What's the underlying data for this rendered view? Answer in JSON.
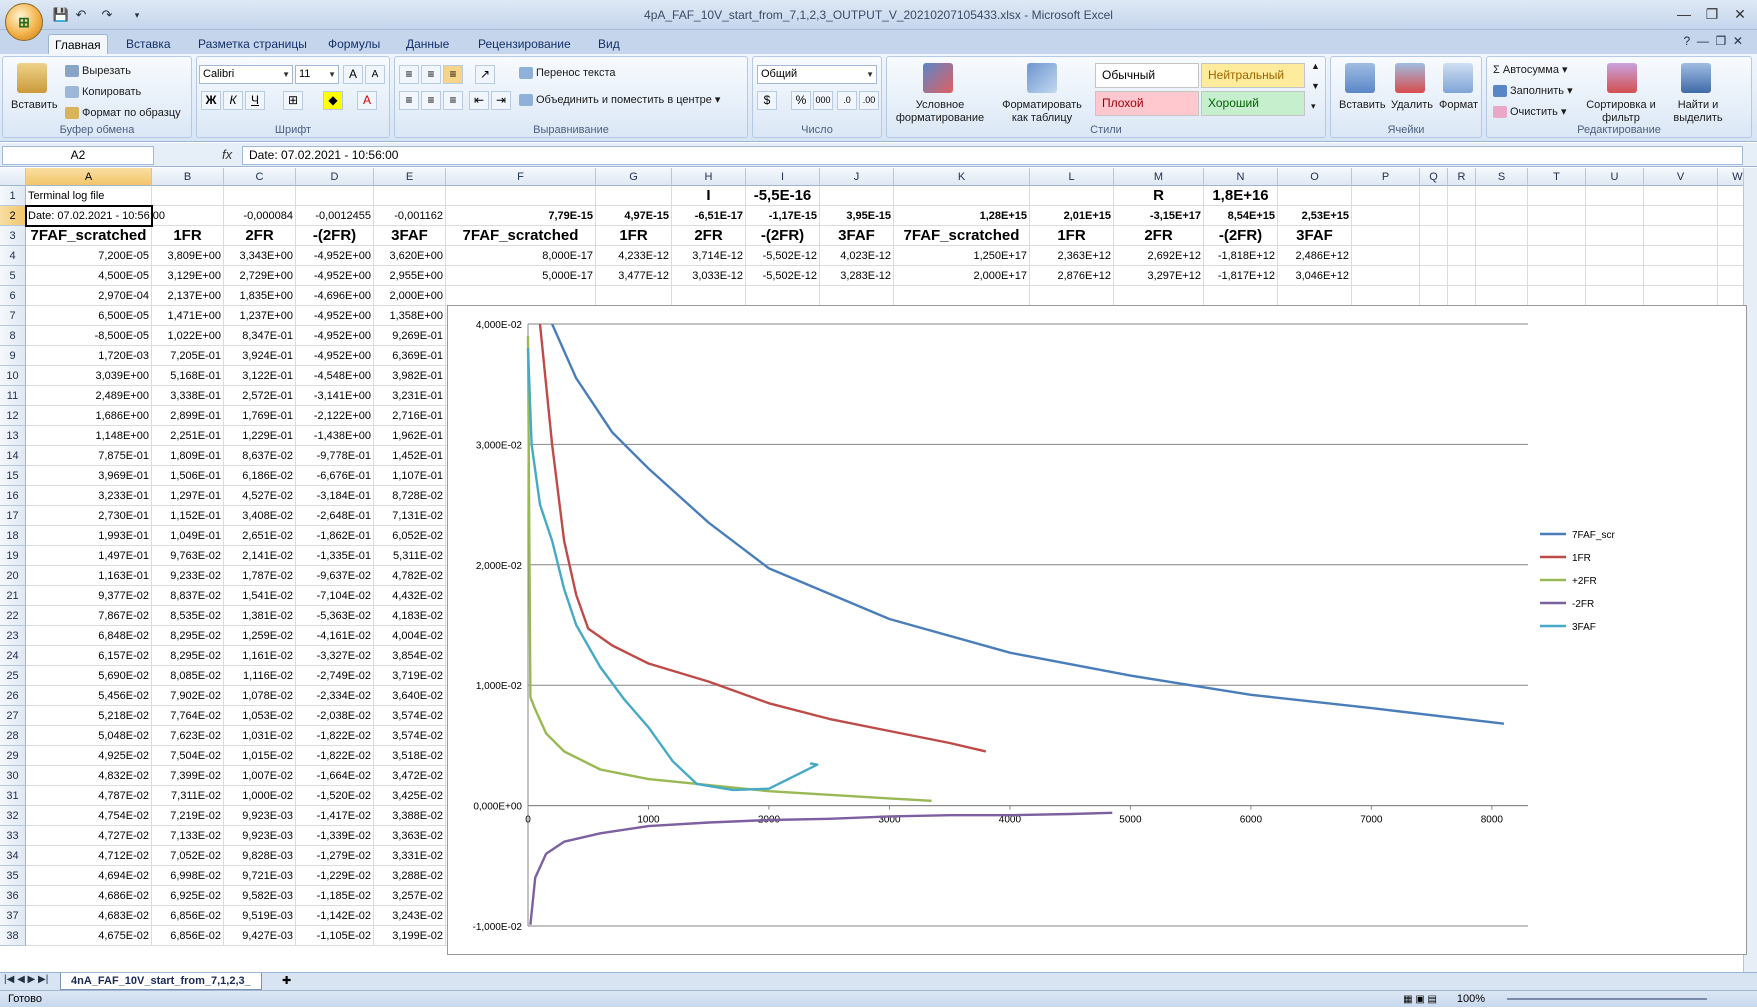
{
  "window": {
    "title": "4pA_FAF_10V_start_from_7,1,2,3_OUTPUT_V_20210207105433.xlsx - Microsoft Excel"
  },
  "tabs": [
    "Главная",
    "Вставка",
    "Разметка страницы",
    "Формулы",
    "Данные",
    "Рецензирование",
    "Вид"
  ],
  "ribbon": {
    "clipboard": {
      "label": "Буфер обмена",
      "paste": "Вставить",
      "cut": "Вырезать",
      "copy": "Копировать",
      "format_painter": "Формат по образцу"
    },
    "font": {
      "label": "Шрифт",
      "name": "Calibri",
      "size": "11"
    },
    "alignment": {
      "label": "Выравнивание",
      "wrap": "Перенос текста",
      "merge": "Объединить и поместить в центре"
    },
    "number": {
      "label": "Число",
      "format": "Общий"
    },
    "styles": {
      "label": "Стили",
      "cond": "Условное форматирование",
      "as_table": "Форматировать как таблицу",
      "normal": "Обычный",
      "neutral": "Нейтральный",
      "bad": "Плохой",
      "good": "Хороший"
    },
    "cells": {
      "label": "Ячейки",
      "insert": "Вставить",
      "delete": "Удалить",
      "format": "Формат"
    },
    "editing": {
      "label": "Редактирование",
      "autosum": "Автосумма",
      "fill": "Заполнить",
      "clear": "Очистить",
      "sort": "Сортировка и фильтр",
      "find": "Найти и выделить"
    }
  },
  "formula_bar": {
    "name_box": "A2",
    "fx": "fx",
    "content": "Date: 07.02.2021 - 10:56:00"
  },
  "columns": [
    "A",
    "B",
    "C",
    "D",
    "E",
    "F",
    "G",
    "H",
    "I",
    "J",
    "K",
    "L",
    "M",
    "N",
    "O",
    "P",
    "Q",
    "R",
    "S",
    "T",
    "U",
    "V",
    "W"
  ],
  "row_numbers": [
    "1",
    "2",
    "3",
    "4",
    "5",
    "6",
    "7",
    "8",
    "9",
    "10",
    "11",
    "12",
    "13",
    "14",
    "15",
    "16",
    "17",
    "18",
    "19",
    "20",
    "21",
    "22",
    "23",
    "24",
    "25",
    "26",
    "27",
    "28",
    "29",
    "30",
    "31",
    "32",
    "33",
    "34",
    "35",
    "36",
    "37",
    "38"
  ],
  "row1": {
    "A": "Terminal log file",
    "H": "I",
    "I": "-5,5E-16",
    "M": "R",
    "N": "1,8E+16"
  },
  "row2": {
    "A": "Date: 07.02.2021 - 10:56:00",
    "C": "-0,000084",
    "D": "-0,0012455",
    "E": "-0,001162",
    "F": "7,79E-15",
    "G": "4,97E-15",
    "H": "-6,51E-17",
    "I": "-1,17E-15",
    "J": "3,95E-15",
    "K": "1,28E+15",
    "L": "2,01E+15",
    "M": "-3,15E+17",
    "N": "8,54E+15",
    "O": "2,53E+15"
  },
  "row3": {
    "A": "7FAF_scratched",
    "B": "1FR",
    "C": "2FR",
    "D": "-(2FR)",
    "E": "3FAF",
    "F": "7FAF_scratched",
    "G": "1FR",
    "H": "2FR",
    "I": "-(2FR)",
    "J": "3FAF",
    "K": "7FAF_scratched",
    "L": "1FR",
    "M": "2FR",
    "N": "-(2FR)",
    "O": "3FAF"
  },
  "row4": {
    "F": "8,000E-17",
    "G": "4,233E-12",
    "H": "3,714E-12",
    "I": "-5,502E-12",
    "J": "4,023E-12",
    "K": "1,250E+17",
    "L": "2,363E+12",
    "M": "2,692E+12",
    "N": "-1,818E+12",
    "O": "2,486E+12"
  },
  "row5": {
    "F": "5,000E-17",
    "G": "3,477E-12",
    "H": "3,033E-12",
    "I": "-5,502E-12",
    "J": "3,283E-12",
    "K": "2,000E+17",
    "L": "2,876E+12",
    "M": "3,297E+12",
    "N": "-1,817E+12",
    "O": "3,046E+12"
  },
  "table_rows": [
    [
      "7,200E-05",
      "3,809E+00",
      "3,343E+00",
      "-4,952E+00",
      "3,620E+00"
    ],
    [
      "4,500E-05",
      "3,129E+00",
      "2,729E+00",
      "-4,952E+00",
      "2,955E+00"
    ],
    [
      "2,970E-04",
      "2,137E+00",
      "1,835E+00",
      "-4,696E+00",
      "2,000E+00"
    ],
    [
      "6,500E-05",
      "1,471E+00",
      "1,237E+00",
      "-4,952E+00",
      "1,358E+00"
    ],
    [
      "-8,500E-05",
      "1,022E+00",
      "8,347E-01",
      "-4,952E+00",
      "9,269E-01"
    ],
    [
      "1,720E-03",
      "7,205E-01",
      "3,924E-01",
      "-4,952E+00",
      "6,369E-01"
    ],
    [
      "3,039E+00",
      "5,168E-01",
      "3,122E-01",
      "-4,548E+00",
      "3,982E-01"
    ],
    [
      "2,489E+00",
      "3,338E-01",
      "2,572E-01",
      "-3,141E+00",
      "3,231E-01"
    ],
    [
      "1,686E+00",
      "2,899E-01",
      "1,769E-01",
      "-2,122E+00",
      "2,716E-01"
    ],
    [
      "1,148E+00",
      "2,251E-01",
      "1,229E-01",
      "-1,438E+00",
      "1,962E-01"
    ],
    [
      "7,875E-01",
      "1,809E-01",
      "8,637E-02",
      "-9,778E-01",
      "1,452E-01"
    ],
    [
      "3,969E-01",
      "1,506E-01",
      "6,186E-02",
      "-6,676E-01",
      "1,107E-01"
    ],
    [
      "3,233E-01",
      "1,297E-01",
      "4,527E-02",
      "-3,184E-01",
      "8,728E-02"
    ],
    [
      "2,730E-01",
      "1,152E-01",
      "3,408E-02",
      "-2,648E-01",
      "7,131E-02"
    ],
    [
      "1,993E-01",
      "1,049E-01",
      "2,651E-02",
      "-1,862E-01",
      "6,052E-02"
    ],
    [
      "1,497E-01",
      "9,763E-02",
      "2,141E-02",
      "-1,335E-01",
      "5,311E-02"
    ],
    [
      "1,163E-01",
      "9,233E-02",
      "1,787E-02",
      "-9,637E-02",
      "4,782E-02"
    ],
    [
      "9,377E-02",
      "8,837E-02",
      "1,541E-02",
      "-7,104E-02",
      "4,432E-02"
    ],
    [
      "7,867E-02",
      "8,535E-02",
      "1,381E-02",
      "-5,363E-02",
      "4,183E-02"
    ],
    [
      "6,848E-02",
      "8,295E-02",
      "1,259E-02",
      "-4,161E-02",
      "4,004E-02"
    ],
    [
      "6,157E-02",
      "8,295E-02",
      "1,161E-02",
      "-3,327E-02",
      "3,854E-02"
    ],
    [
      "5,690E-02",
      "8,085E-02",
      "1,116E-02",
      "-2,749E-02",
      "3,719E-02"
    ],
    [
      "5,456E-02",
      "7,902E-02",
      "1,078E-02",
      "-2,334E-02",
      "3,640E-02"
    ],
    [
      "5,218E-02",
      "7,764E-02",
      "1,053E-02",
      "-2,038E-02",
      "3,574E-02"
    ],
    [
      "5,048E-02",
      "7,623E-02",
      "1,031E-02",
      "-1,822E-02",
      "3,574E-02"
    ],
    [
      "4,925E-02",
      "7,504E-02",
      "1,015E-02",
      "-1,822E-02",
      "3,518E-02"
    ],
    [
      "4,832E-02",
      "7,399E-02",
      "1,007E-02",
      "-1,664E-02",
      "3,472E-02"
    ],
    [
      "4,787E-02",
      "7,311E-02",
      "1,000E-02",
      "-1,520E-02",
      "3,425E-02"
    ],
    [
      "4,754E-02",
      "7,219E-02",
      "9,923E-03",
      "-1,417E-02",
      "3,388E-02"
    ],
    [
      "4,727E-02",
      "7,133E-02",
      "9,923E-03",
      "-1,339E-02",
      "3,363E-02"
    ],
    [
      "4,712E-02",
      "7,052E-02",
      "9,828E-03",
      "-1,279E-02",
      "3,331E-02"
    ],
    [
      "4,694E-02",
      "6,998E-02",
      "9,721E-03",
      "-1,229E-02",
      "3,288E-02"
    ],
    [
      "4,686E-02",
      "6,925E-02",
      "9,582E-03",
      "-1,185E-02",
      "3,257E-02"
    ],
    [
      "4,683E-02",
      "6,856E-02",
      "9,519E-03",
      "-1,142E-02",
      "3,243E-02"
    ],
    [
      "4,675E-02",
      "6,856E-02",
      "9,427E-03",
      "-1,105E-02",
      "3,199E-02"
    ]
  ],
  "chart_data": {
    "type": "line",
    "yticks": [
      "4,000E-02",
      "3,000E-02",
      "2,000E-02",
      "1,000E-02",
      "0,000E+00",
      "-1,000E-02"
    ],
    "xticks": [
      "0",
      "1000",
      "2000",
      "3000",
      "4000",
      "5000",
      "6000",
      "7000",
      "8000"
    ],
    "ylim": [
      -0.01,
      0.04
    ],
    "xlim": [
      0,
      8300
    ],
    "legend_position": "right",
    "series": [
      {
        "name": "7FAF_scr",
        "color": "#4a7ebb",
        "points": [
          [
            200,
            0.04
          ],
          [
            400,
            0.0355
          ],
          [
            700,
            0.031
          ],
          [
            1000,
            0.028
          ],
          [
            1500,
            0.0235
          ],
          [
            2000,
            0.0197
          ],
          [
            3000,
            0.0155
          ],
          [
            4000,
            0.0127
          ],
          [
            5000,
            0.0108
          ],
          [
            6000,
            0.0092
          ],
          [
            7000,
            0.0081
          ],
          [
            8100,
            0.0068
          ]
        ]
      },
      {
        "name": "1FR",
        "color": "#be4b48",
        "points": [
          [
            100,
            0.04
          ],
          [
            200,
            0.03
          ],
          [
            300,
            0.022
          ],
          [
            400,
            0.0175
          ],
          [
            500,
            0.0147
          ],
          [
            700,
            0.0133
          ],
          [
            1000,
            0.0118
          ],
          [
            1500,
            0.0103
          ],
          [
            2000,
            0.0085
          ],
          [
            2500,
            0.0072
          ],
          [
            3000,
            0.0062
          ],
          [
            3500,
            0.0052
          ],
          [
            3800,
            0.0045
          ]
        ]
      },
      {
        "name": "+2FR",
        "color": "#98b954",
        "points": [
          [
            0,
            0.039
          ],
          [
            20,
            0.009
          ],
          [
            60,
            0.008
          ],
          [
            150,
            0.006
          ],
          [
            300,
            0.0045
          ],
          [
            600,
            0.003
          ],
          [
            1000,
            0.0022
          ],
          [
            1500,
            0.0017
          ],
          [
            2000,
            0.0012
          ],
          [
            2500,
            0.0009
          ],
          [
            3000,
            0.0006
          ],
          [
            3350,
            0.0004
          ]
        ]
      },
      {
        "name": "-2FR",
        "color": "#7d60a0",
        "points": [
          [
            20,
            -0.0099
          ],
          [
            60,
            -0.006
          ],
          [
            150,
            -0.004
          ],
          [
            300,
            -0.003
          ],
          [
            600,
            -0.0023
          ],
          [
            1000,
            -0.0017
          ],
          [
            1500,
            -0.0014
          ],
          [
            2000,
            -0.0012
          ],
          [
            2500,
            -0.0011
          ],
          [
            3000,
            -0.0009
          ],
          [
            3500,
            -0.0008
          ],
          [
            4000,
            -0.0008
          ],
          [
            4500,
            -0.0007
          ],
          [
            4850,
            -0.0006
          ]
        ]
      },
      {
        "name": "3FAF",
        "color": "#46aac5",
        "points": [
          [
            0,
            0.038
          ],
          [
            30,
            0.03
          ],
          [
            100,
            0.025
          ],
          [
            200,
            0.022
          ],
          [
            300,
            0.018
          ],
          [
            400,
            0.015
          ],
          [
            600,
            0.0115
          ],
          [
            800,
            0.0088
          ],
          [
            1000,
            0.0065
          ],
          [
            1200,
            0.0037
          ],
          [
            1400,
            0.0018
          ],
          [
            1700,
            0.0013
          ],
          [
            2000,
            0.0014
          ],
          [
            2400,
            0.0034
          ],
          [
            2350,
            0.0035
          ],
          [
            2350,
            0.0034
          ]
        ]
      }
    ]
  },
  "sheet_tab": "4nA_FAF_10V_start_from_7,1,2,3_",
  "status": {
    "ready": "Готово",
    "zoom": "100%"
  }
}
